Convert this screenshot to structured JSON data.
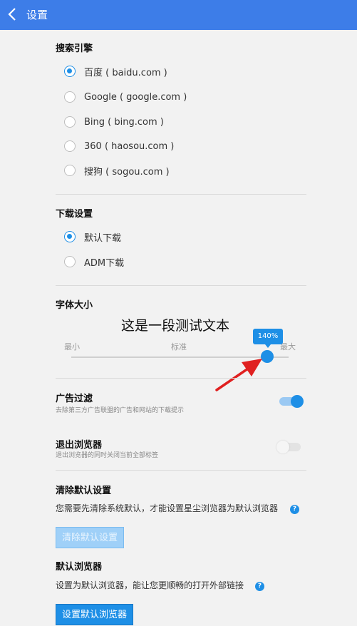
{
  "header": {
    "title": "设置"
  },
  "search_engine": {
    "heading": "搜索引擎",
    "options": [
      {
        "label": "百度 ( baidu.com )",
        "selected": true
      },
      {
        "label": "Google ( google.com )",
        "selected": false
      },
      {
        "label": "Bing ( bing.com )",
        "selected": false
      },
      {
        "label": "360 ( haosou.com )",
        "selected": false
      },
      {
        "label": "搜狗 ( sogou.com )",
        "selected": false
      }
    ]
  },
  "download": {
    "heading": "下载设置",
    "options": [
      {
        "label": "默认下载",
        "selected": true
      },
      {
        "label": "ADM下载",
        "selected": false
      }
    ]
  },
  "font_size": {
    "heading": "字体大小",
    "sample_text": "这是一段测试文本",
    "min_label": "最小",
    "mid_label": "标准",
    "max_label": "最大",
    "value_label": "140%"
  },
  "ad_filter": {
    "title": "广告过滤",
    "subtitle": "去除第三方广告联盟的广告和网站的下载提示",
    "enabled": true
  },
  "exit_browser": {
    "title": "退出浏览器",
    "subtitle": "退出浏览器的同时关闭当前全部标签",
    "enabled": false
  },
  "clear_default": {
    "heading": "清除默认设置",
    "description": "您需要先清除系统默认，才能设置星尘浏览器为默认浏览器",
    "button": "清除默认设置"
  },
  "default_browser": {
    "heading": "默认浏览器",
    "description": "设置为默认浏览器，能让您更顺畅的打开外部链接",
    "button": "设置默认浏览器"
  },
  "colors": {
    "accent": "#1e8fe6",
    "header": "#3d7de8",
    "annotation_arrow": "#e02020"
  }
}
